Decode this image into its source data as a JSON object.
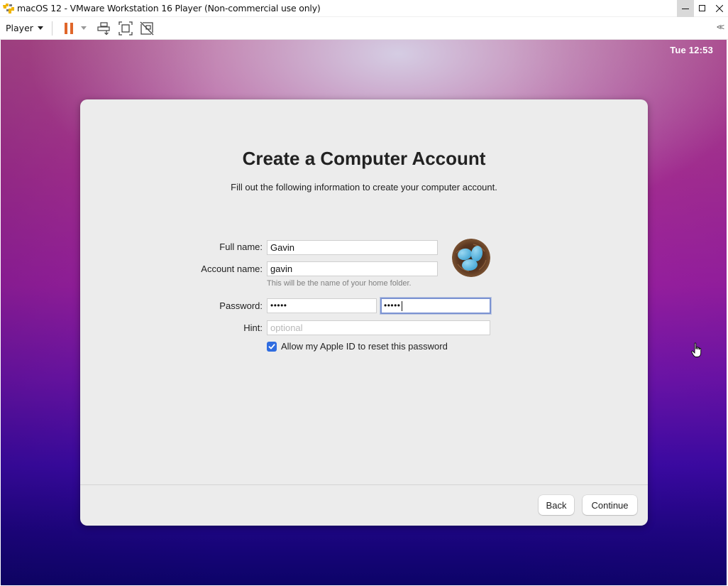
{
  "window": {
    "title": "macOS 12 - VMware Workstation 16 Player (Non-commercial use only)",
    "app_icon": "vmware-icon",
    "controls": [
      "minimize-icon",
      "maximize-icon",
      "close-icon"
    ]
  },
  "toolbar": {
    "player_menu_label": "Player",
    "icons": [
      "pause-icon",
      "send-ctrl-alt-del-icon",
      "fullscreen-icon",
      "unity-icon"
    ],
    "collapse_glyph": "<<"
  },
  "vm": {
    "clock": "Tue 12:53",
    "dialog": {
      "title": "Create a Computer Account",
      "subtitle": "Fill out the following information to create your computer account.",
      "fields": {
        "full_name": {
          "label": "Full name:",
          "value": "Gavin"
        },
        "account_name": {
          "label": "Account name:",
          "value": "gavin",
          "helper": "This will be the name of your home folder."
        },
        "password": {
          "label": "Password:",
          "value_masked": "•••••",
          "verify_masked": "•••••"
        },
        "hint": {
          "label": "Hint:",
          "placeholder": "optional",
          "value": ""
        }
      },
      "allow_apple_id_reset": {
        "label": "Allow my Apple ID to reset this password",
        "checked": true
      },
      "avatar": "bird-nest-eggs-avatar",
      "buttons": {
        "back": "Back",
        "continue": "Continue"
      }
    }
  },
  "colors": {
    "accent": "#2f6ce0",
    "focus_ring": "#7b93d2",
    "pause_orange": "#e0662a",
    "dialog_bg": "#ececec"
  }
}
